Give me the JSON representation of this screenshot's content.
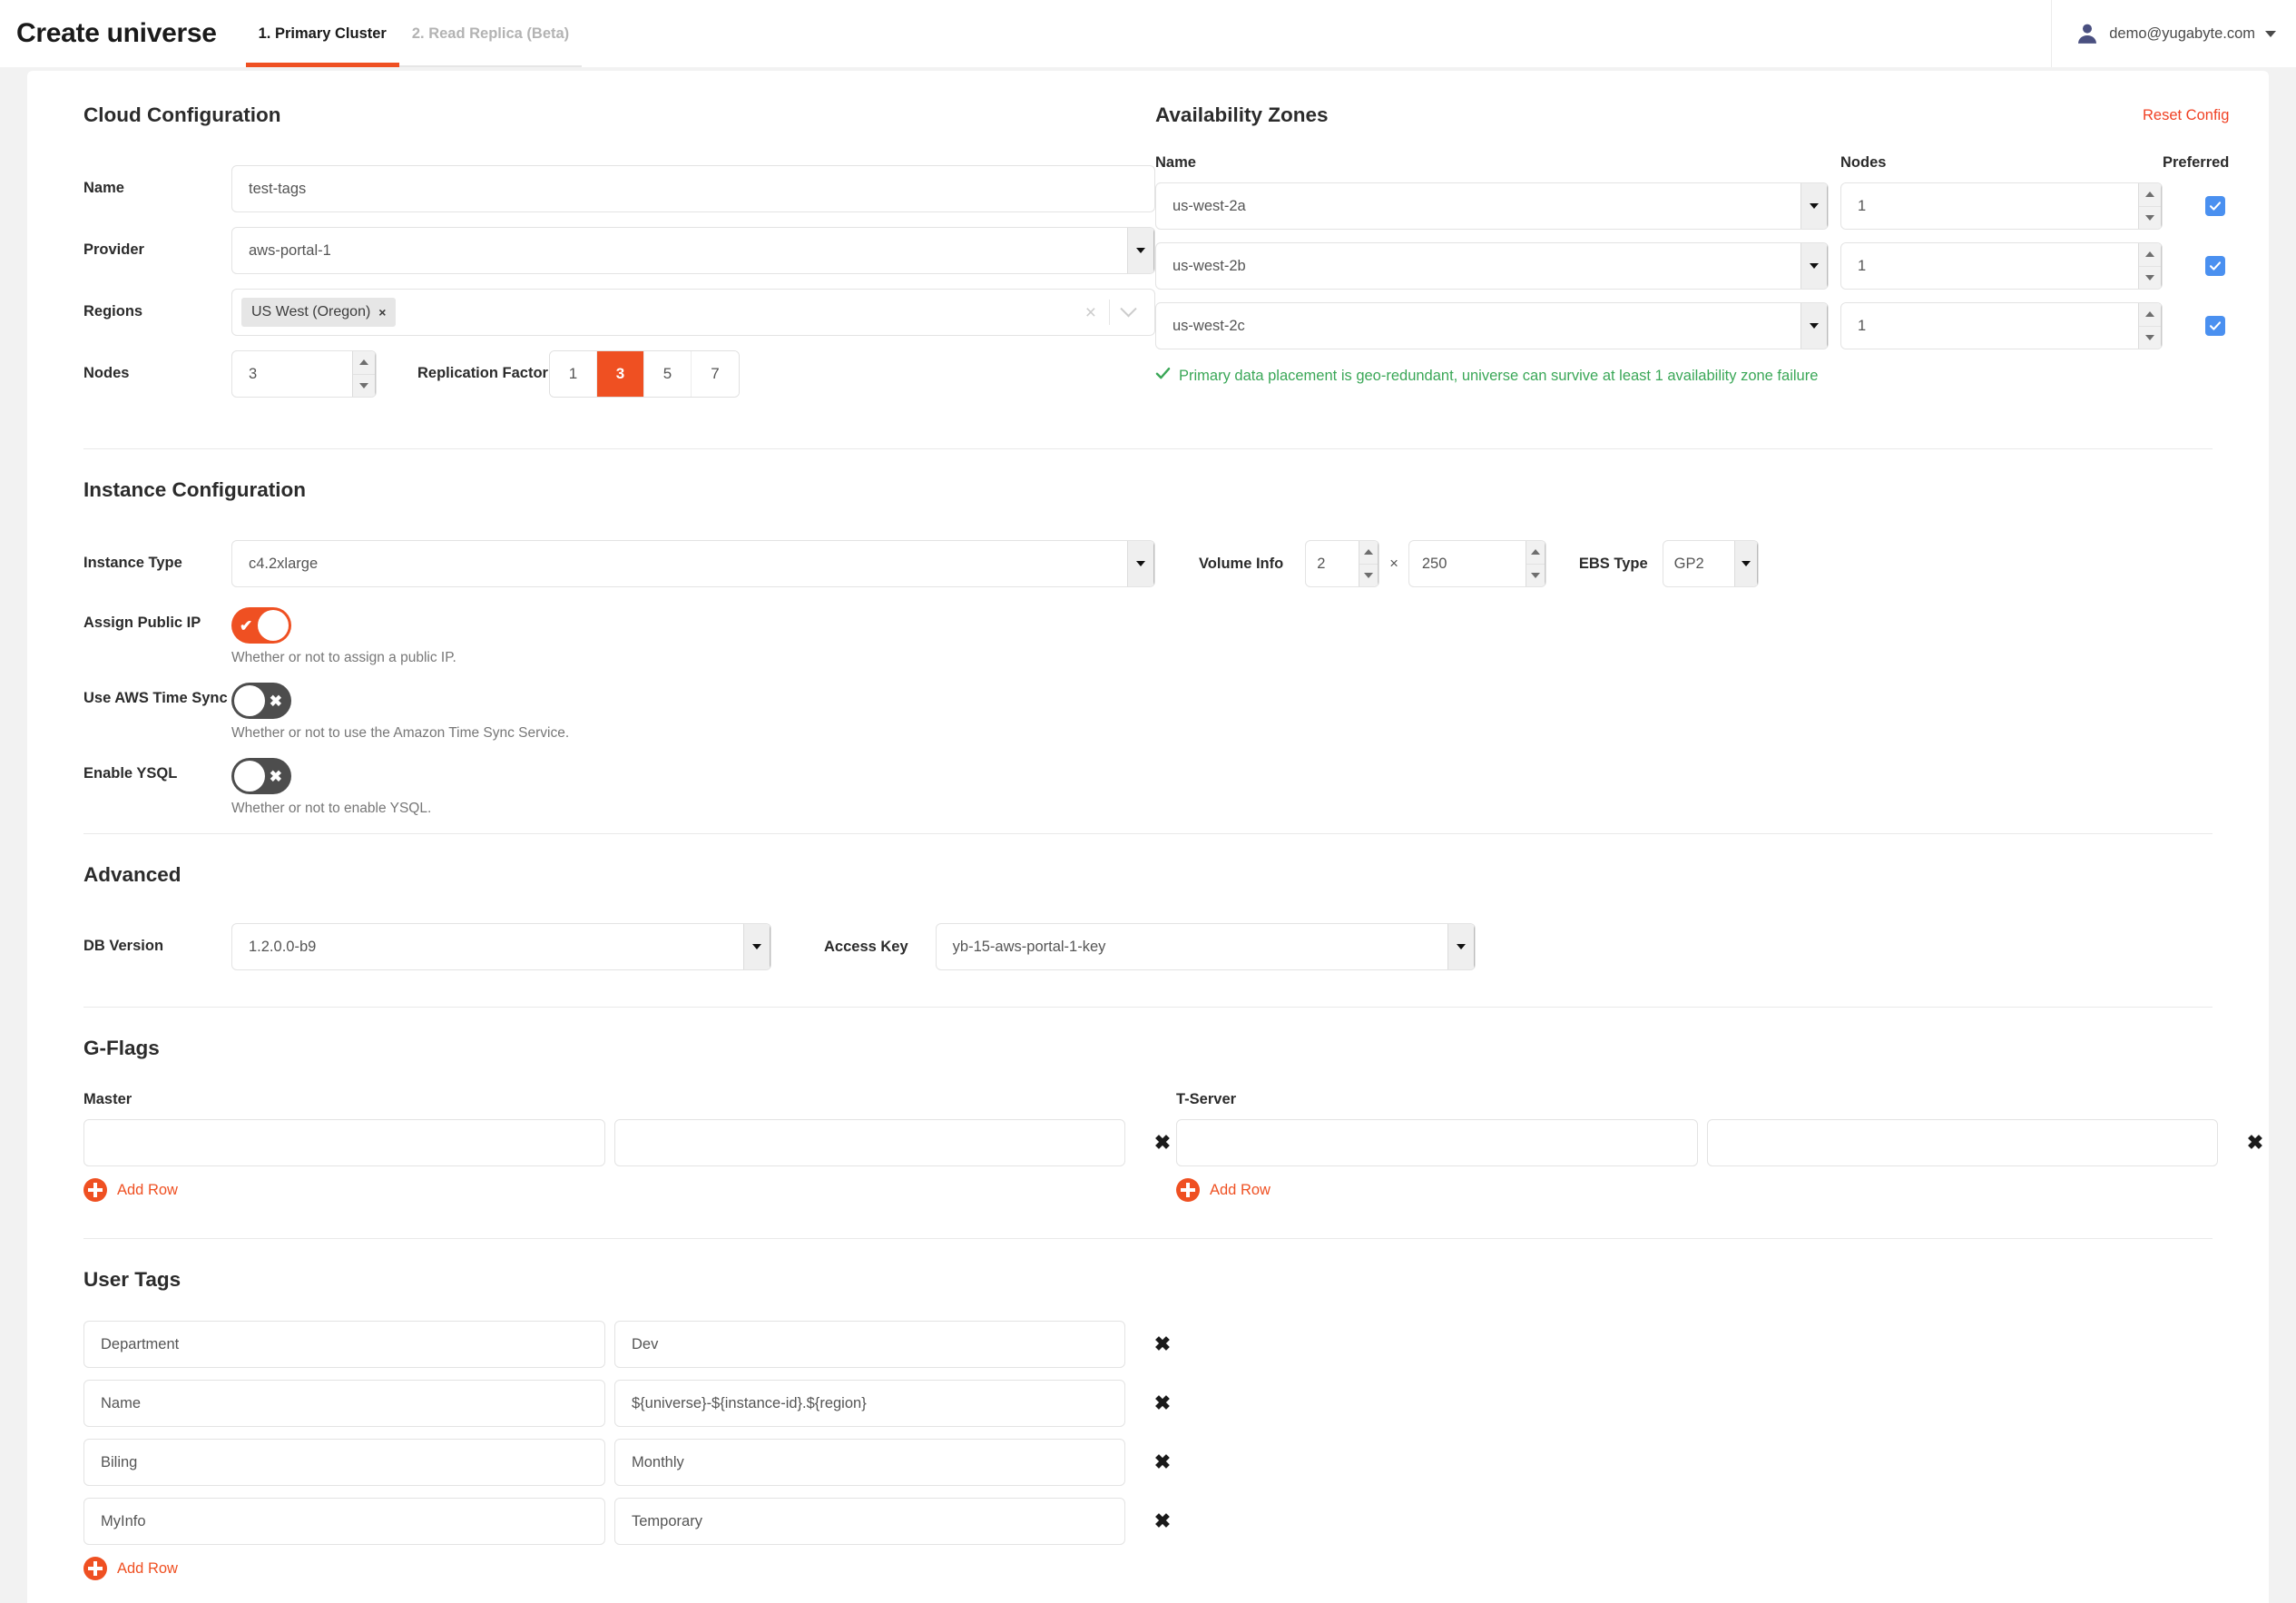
{
  "header": {
    "app_title": "Create universe",
    "tabs": [
      {
        "label": "1. Primary Cluster",
        "active": true
      },
      {
        "label": "2. Read Replica (Beta)",
        "active": false
      }
    ],
    "user_email": "demo@yugabyte.com",
    "avatar_icon": "user-avatar-icon",
    "caret_icon": "chevron-down-icon"
  },
  "colors": {
    "accent": "#ef5022",
    "link": "#f04124",
    "success": "#3aa757",
    "checkbox": "#4a90f0"
  },
  "cloud_config": {
    "title": "Cloud Configuration",
    "name_label": "Name",
    "name_value": "test-tags",
    "provider_label": "Provider",
    "provider_value": "aws-portal-1",
    "regions_label": "Regions",
    "region_chips": [
      "US West (Oregon)"
    ],
    "chip_remove": "×",
    "nodes_label": "Nodes",
    "nodes_value": "3",
    "replication_label": "Replication Factor",
    "replication_options": [
      "1",
      "3",
      "5",
      "7"
    ],
    "replication_selected": "3"
  },
  "availability_zones": {
    "title": "Availability Zones",
    "reset_label": "Reset Config",
    "col_name": "Name",
    "col_nodes": "Nodes",
    "col_preferred": "Preferred",
    "rows": [
      {
        "name": "us-west-2a",
        "nodes": "1",
        "preferred": true
      },
      {
        "name": "us-west-2b",
        "nodes": "1",
        "preferred": true
      },
      {
        "name": "us-west-2c",
        "nodes": "1",
        "preferred": true
      }
    ],
    "status_message": "Primary data placement is geo-redundant, universe can survive at least 1 availability zone failure",
    "status_icon": "check-icon"
  },
  "instance_config": {
    "title": "Instance Configuration",
    "instance_type_label": "Instance Type",
    "instance_type_value": "c4.2xlarge",
    "volume_info_label": "Volume Info",
    "volume_count": "2",
    "volume_times": "×",
    "volume_size": "250",
    "ebs_type_label": "EBS Type",
    "ebs_type_value": "GP2",
    "toggles": [
      {
        "label": "Assign Public IP",
        "state": "on",
        "mark": "✔",
        "help": "Whether or not to assign a public IP."
      },
      {
        "label": "Use AWS Time Sync",
        "state": "off",
        "mark": "✖",
        "help": "Whether or not to use the Amazon Time Sync Service."
      },
      {
        "label": "Enable YSQL",
        "state": "off",
        "mark": "✖",
        "help": "Whether or not to enable YSQL."
      }
    ]
  },
  "advanced": {
    "title": "Advanced",
    "db_version_label": "DB Version",
    "db_version_value": "1.2.0.0-b9",
    "access_key_label": "Access Key",
    "access_key_value": "yb-15-aws-portal-1-key"
  },
  "gflags": {
    "title": "G-Flags",
    "master_label": "Master",
    "tserver_label": "T-Server",
    "add_row_label": "Add Row",
    "remove_label": "✖",
    "master_rows": [
      {
        "key": "",
        "value": ""
      }
    ],
    "tserver_rows": [
      {
        "key": "",
        "value": ""
      }
    ]
  },
  "user_tags": {
    "title": "User Tags",
    "add_row_label": "Add Row",
    "remove_label": "✖",
    "rows": [
      {
        "key": "Department",
        "value": "Dev"
      },
      {
        "key": "Name",
        "value": "${universe}-${instance-id}.${region}"
      },
      {
        "key": "Biling",
        "value": "Monthly"
      },
      {
        "key": "MyInfo",
        "value": "Temporary"
      }
    ]
  }
}
